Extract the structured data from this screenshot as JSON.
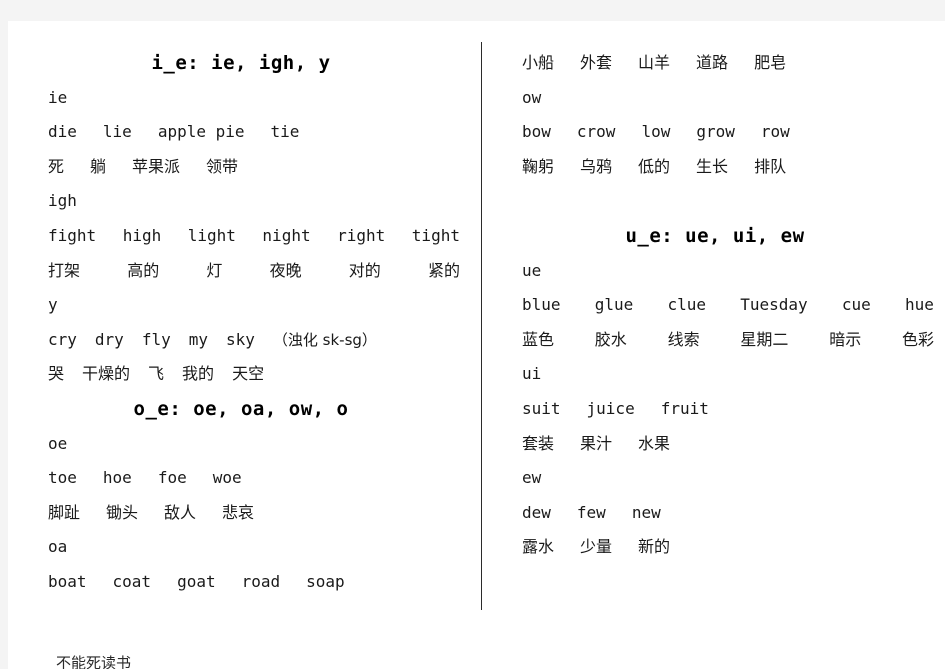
{
  "document": {
    "page_background": "#ffffff",
    "canvas_background": "#f4f4f4",
    "text_color": "#1a1a1a",
    "divider_color": "#2b2b2b"
  },
  "left_column": {
    "rows": [
      {
        "kind": "title",
        "text": "i_e: ie, igh, y"
      },
      {
        "kind": "pattern",
        "text": "ie"
      },
      {
        "kind": "en",
        "spread": "mid",
        "items": [
          "die",
          "lie",
          "apple pie",
          "tie"
        ]
      },
      {
        "kind": "zh",
        "spread": "mid",
        "items": [
          "死",
          "躺",
          "苹果派",
          "领带"
        ]
      },
      {
        "kind": "pattern",
        "text": "igh"
      },
      {
        "kind": "en",
        "spread": "wide",
        "items": [
          "fight",
          "high",
          "light",
          "night",
          "right",
          "tight"
        ]
      },
      {
        "kind": "zh",
        "spread": "wide",
        "items": [
          "打架",
          "高的",
          "灯",
          "夜晚",
          "对的",
          "紧的"
        ]
      },
      {
        "kind": "pattern",
        "text": "y"
      },
      {
        "kind": "en",
        "spread": "tight",
        "items": [
          "cry",
          "dry",
          "fly",
          "my",
          "sky",
          "（浊化 sk-sg）"
        ]
      },
      {
        "kind": "zh",
        "spread": "tight",
        "items": [
          "哭",
          "干燥的",
          "飞",
          "我的",
          "天空"
        ]
      },
      {
        "kind": "title",
        "text": "o_e: oe, oa, ow, o"
      },
      {
        "kind": "pattern",
        "text": "oe"
      },
      {
        "kind": "en",
        "spread": "mid",
        "items": [
          "toe",
          "hoe",
          "foe",
          "woe"
        ]
      },
      {
        "kind": "zh",
        "spread": "mid",
        "items": [
          "脚趾",
          "锄头",
          "敌人",
          "悲哀"
        ]
      },
      {
        "kind": "pattern",
        "text": "oa"
      },
      {
        "kind": "en",
        "spread": "mid",
        "items": [
          "boat",
          "coat",
          "goat",
          "road",
          "soap"
        ]
      }
    ]
  },
  "right_column": {
    "rows": [
      {
        "kind": "zh",
        "spread": "mid",
        "items": [
          "小船",
          "外套",
          "山羊",
          "道路",
          "肥皂"
        ]
      },
      {
        "kind": "pattern",
        "text": "ow"
      },
      {
        "kind": "en",
        "spread": "mid",
        "items": [
          "bow",
          "crow",
          "low",
          "grow",
          "row"
        ]
      },
      {
        "kind": "zh",
        "spread": "mid",
        "items": [
          "鞠躬",
          "乌鸦",
          "低的",
          "生长",
          "排队"
        ]
      },
      {
        "kind": "blank"
      },
      {
        "kind": "title",
        "text": "u_e: ue, ui, ew"
      },
      {
        "kind": "pattern",
        "text": "ue"
      },
      {
        "kind": "en",
        "spread": "wide",
        "items": [
          "blue",
          "glue",
          "clue",
          "Tuesday",
          "cue",
          "hue"
        ]
      },
      {
        "kind": "zh",
        "spread": "wide",
        "items": [
          "蓝色",
          "胶水",
          "线索",
          "星期二",
          "暗示",
          "色彩"
        ]
      },
      {
        "kind": "pattern",
        "text": "ui"
      },
      {
        "kind": "en",
        "spread": "mid",
        "items": [
          "suit",
          "juice",
          "fruit"
        ]
      },
      {
        "kind": "zh",
        "spread": "mid",
        "items": [
          "套装",
          "果汁",
          "水果"
        ]
      },
      {
        "kind": "pattern",
        "text": "ew"
      },
      {
        "kind": "en",
        "spread": "mid",
        "items": [
          "dew",
          "few",
          "new"
        ]
      },
      {
        "kind": "zh",
        "spread": "mid",
        "items": [
          "露水",
          "少量",
          "新的"
        ]
      }
    ]
  },
  "footer": {
    "clipped_text": "不能死读书"
  }
}
